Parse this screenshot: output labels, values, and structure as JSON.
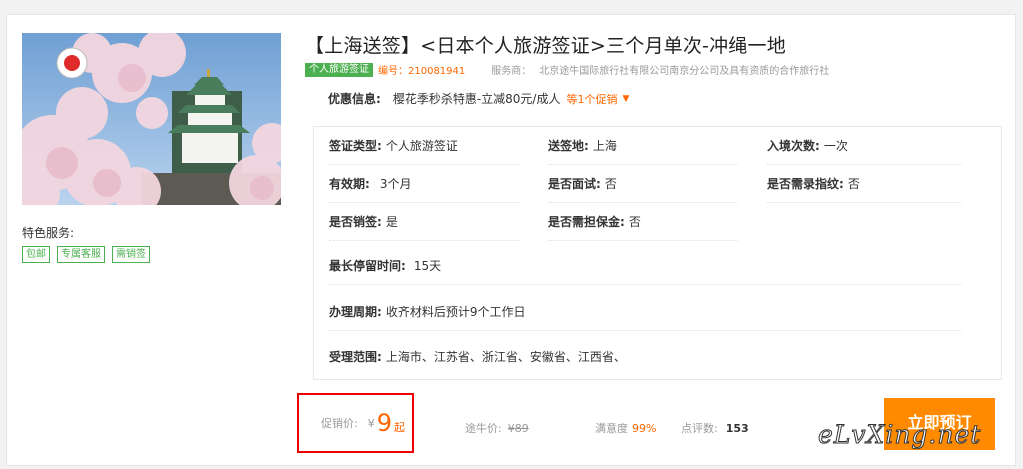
{
  "product": {
    "title": "【上海送签】<日本个人旅游签证>三个月单次-冲绳一地",
    "type_badge": "个人旅游签证",
    "code": "编号：210081941",
    "provider_label": "服务商：",
    "provider": "北京途牛国际旅行社有限公司南京分公司及具有资质的合作旅行社"
  },
  "promo": {
    "label": "优惠信息:",
    "text": "樱花季秒杀特惠-立减80元/成人",
    "more": "等1个促销"
  },
  "features": {
    "label": "特色服务:",
    "tags": [
      "包邮",
      "专属客服",
      "需销签"
    ]
  },
  "details": {
    "visa_type": {
      "label": "签证类型:",
      "value": "个人旅游签证"
    },
    "send_location": {
      "label": "送签地:",
      "value": "上海"
    },
    "entries": {
      "label": "入境次数:",
      "value": "一次"
    },
    "validity": {
      "label": "有效期:",
      "value": "3个月"
    },
    "interview": {
      "label": "是否面试:",
      "value": "否"
    },
    "fingerprint": {
      "label": "是否需录指纹:",
      "value": "否"
    },
    "cancel_visa": {
      "label": "是否销签:",
      "value": "是"
    },
    "deposit": {
      "label": "是否需担保金:",
      "value": "否"
    },
    "max_stay": {
      "label": "最长停留时间:",
      "value": "15天"
    },
    "processing": {
      "label": "办理周期:",
      "value": "收齐材料后预计9个工作日"
    },
    "scope": {
      "label": "受理范围:",
      "value": "上海市、江苏省、浙江省、安徽省、江西省、"
    }
  },
  "pricing": {
    "promo_label": "促销价:",
    "currency": "¥",
    "price": "9",
    "suffix": "起",
    "tuniu_label": "途牛价:",
    "tuniu_price": "¥89",
    "satisfaction_label": "满意度",
    "satisfaction": "99%",
    "reviews_label": "点评数:",
    "reviews": "153"
  },
  "book_button": "立即预订",
  "watermark": "eLvXing.net",
  "colors": {
    "accent": "#ff6600",
    "button": "#ff8a00",
    "tag_green": "#4caf50",
    "highlight_border": "#ee0000"
  }
}
